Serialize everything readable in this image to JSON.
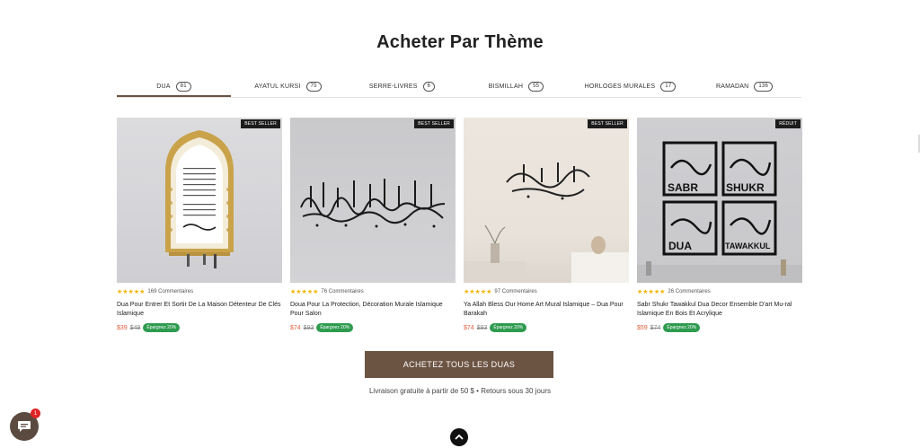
{
  "section_title": "Acheter Par Thème",
  "tabs": [
    {
      "label": "DUA",
      "count": "81"
    },
    {
      "label": "AYATUL KURSI",
      "count": "75"
    },
    {
      "label": "SERRE-LIVRES",
      "count": "6"
    },
    {
      "label": "BISMILLAH",
      "count": "55"
    },
    {
      "label": "HORLOGES MURALES",
      "count": "17"
    },
    {
      "label": "RAMADAN",
      "count": "136"
    }
  ],
  "products": [
    {
      "badge": "BEST SELLER",
      "reviews": "169 Commentaires",
      "name": "Dua Pour Entrer Et Sortir De La Maison Détenteur De Clés Islamique",
      "price": "$39",
      "old_price": "$49",
      "save": "Épargnez 20%"
    },
    {
      "badge": "BEST SELLER",
      "reviews": "76 Commentaires",
      "name": "Doua Pour La Protection, Décoration Murale Islamique Pour Salon",
      "price": "$74",
      "old_price": "$93",
      "save": "Épargnez 20%"
    },
    {
      "badge": "BEST SELLER",
      "reviews": "97 Commentaires",
      "name": "Ya Allah Bless Our Home Art Mural Islamique – Dua Pour Barakah",
      "price": "$74",
      "old_price": "$93",
      "save": "Épargnez 20%"
    },
    {
      "badge": "RÉDUIT",
      "reviews": "26 Commentaires",
      "name": "Sabr Shukr Tawakkul Dua Decor Ensemble D'art Mu-ral Islamique En Bois Et Acrylique",
      "price": "$59",
      "old_price": "$74",
      "save": "Épargnez 20%"
    }
  ],
  "art_words": [
    "SABR",
    "SHUKR",
    "DUA",
    "TAWAKKUL"
  ],
  "stars": "★★★★★",
  "cta_label": "ACHETEZ TOUS LES DUAS",
  "shipping_note": "Livraison gratuite à partir de 50 $ • Retours sous 30 jours",
  "chat_badge": "1",
  "colors": {
    "accent": "#6c5443",
    "sale": "#e15a3c",
    "save_badge": "#2e9b4f",
    "stars": "#f5b400"
  }
}
